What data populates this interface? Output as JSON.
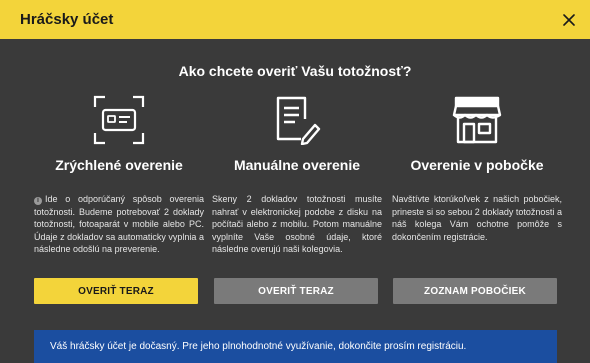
{
  "header": {
    "title": "Hráčsky účet",
    "close_icon": "close-icon"
  },
  "main": {
    "heading": "Ako chcete overiť Vašu totožnosť?",
    "options": [
      {
        "icon": "id-card-icon",
        "title": "Zrýchlené overenie",
        "description": "Ide o odporúčaný spôsob overenia totožnosti. Budeme potrebovať 2 doklady totožnosti, fotoaparát v mobile alebo PC. Údaje z dokladov sa automaticky vyplnia a následne odošlú na preverenie.",
        "button": "OVERIŤ TERAZ"
      },
      {
        "icon": "document-edit-icon",
        "title": "Manuálne overenie",
        "description": "Skeny 2 dokladov totožnosti musíte nahrať v elektronickej podobe z disku na počítači alebo z mobilu. Potom manuálne vyplníte Vaše osobné údaje, ktoré následne overujú naši kolegovia.",
        "button": "OVERIŤ TERAZ"
      },
      {
        "icon": "storefront-icon",
        "title": "Overenie v pobočke",
        "description": "Navštívte ktorúkoľvek z našich pobočiek, prineste si so sebou 2 doklady totožnosti a náš kolega Vám ochotne pomôže s dokončením registrácie.",
        "button": "ZOZNAM POBOČIEK"
      }
    ]
  },
  "notice": {
    "text": "Váš hráčsky účet je dočasný. Pre jeho plnohodnotné využívanie, dokončite prosím registráciu."
  },
  "colors": {
    "accent": "#f3d43a",
    "background": "#3a3a3a",
    "secondary_button": "#7a7a7a",
    "notice": "#1b4ea0"
  }
}
